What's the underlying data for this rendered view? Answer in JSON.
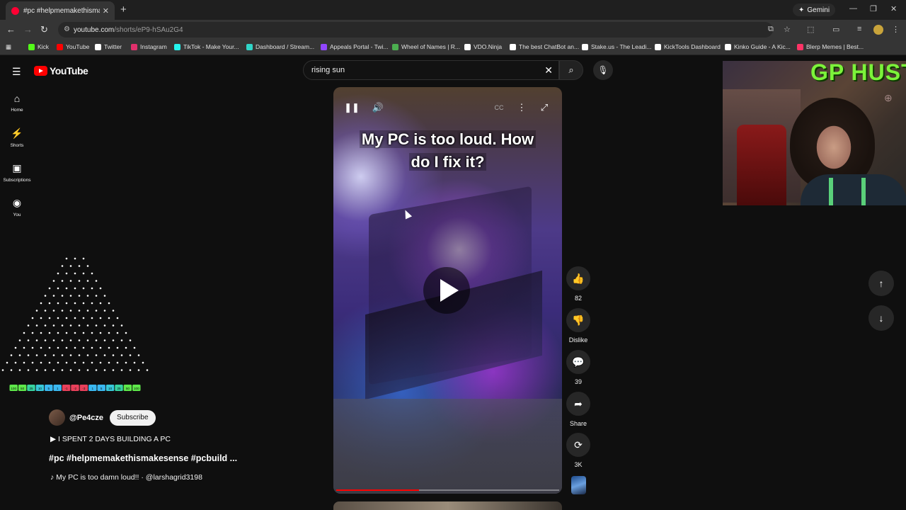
{
  "browser": {
    "tab_title": "#pc #helpmemakethismakesense",
    "url_host": "youtube.com",
    "url_path": "/shorts/eP9-hSAu2G4",
    "gemini_label": "Gemini",
    "bookmarks": [
      {
        "label": "Kick",
        "color": "#53fc18"
      },
      {
        "label": "YouTube",
        "color": "#ff0000"
      },
      {
        "label": "Twitter",
        "color": "#ffffff"
      },
      {
        "label": "Instagram",
        "color": "#e1306c"
      },
      {
        "label": "TikTok - Make Your...",
        "color": "#25f4ee"
      },
      {
        "label": "Dashboard / Stream...",
        "color": "#30d5c8"
      },
      {
        "label": "Appeals Portal - Twi...",
        "color": "#9146ff"
      },
      {
        "label": "Wheel of Names | R...",
        "color": "#4caf50"
      },
      {
        "label": "VDO.Ninja",
        "color": "#ffffff"
      },
      {
        "label": "The best ChatBot an...",
        "color": "#ffffff"
      },
      {
        "label": "Stake.us - The Leadi...",
        "color": "#ffffff"
      },
      {
        "label": "KickTools Dashboard",
        "color": "#ffffff"
      },
      {
        "label": "Kinko Guide - A Kic...",
        "color": "#ffffff"
      },
      {
        "label": "Blerp Memes | Best...",
        "color": "#ff3366"
      }
    ]
  },
  "youtube": {
    "logo_text": "YouTube",
    "search_query": "rising sun",
    "sidebar": [
      {
        "icon": "home-icon",
        "label": "Home"
      },
      {
        "icon": "shorts-icon",
        "label": "Shorts"
      },
      {
        "icon": "subscriptions-icon",
        "label": "Subscriptions"
      },
      {
        "icon": "you-icon",
        "label": "You"
      }
    ],
    "channel": {
      "handle": "@Pe4cze",
      "subscribe_label": "Subscribe"
    },
    "playlist_label": "I SPENT 2 DAYS BUILDING A PC",
    "video_title": "#pc #helpmemakethismakesense #pcbuild ...",
    "audio_label": "My PC is too damn loud!! · @larshagrid3198",
    "video_caption_line1": "My PC is too loud. How",
    "video_caption_line2": "do I fix it?",
    "progress_fraction": 0.37,
    "actions": {
      "likes": "82",
      "dislike_label": "Dislike",
      "comments": "39",
      "share_label": "Share",
      "remix": "3K"
    }
  },
  "overlay": {
    "stream_banner": "GP HUSTLA",
    "triangle_labels": [
      "100",
      "50",
      "25",
      "10",
      "5",
      "1",
      "-1",
      "-2",
      "-3",
      "1",
      "5",
      "10",
      "25",
      "50",
      "100"
    ]
  },
  "colors": {
    "accent_red": "#ff0000",
    "banner_green": "#7cf23a"
  }
}
